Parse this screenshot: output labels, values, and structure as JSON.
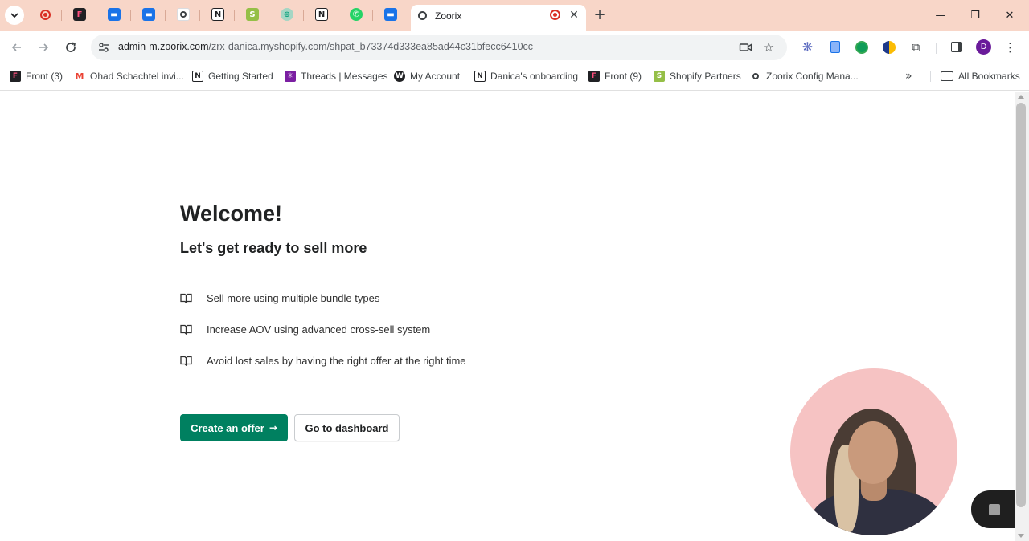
{
  "browser": {
    "active_tab": {
      "title": "Zoorix",
      "favicon": "zoorix-icon"
    },
    "pinned_tabs": [
      {
        "icon": "record-icon",
        "color": "#d93025"
      },
      {
        "icon": "front-icon",
        "color": "#c2185b"
      },
      {
        "icon": "messages-icon",
        "color": "#1a73e8"
      },
      {
        "icon": "messages-icon",
        "color": "#1a73e8"
      },
      {
        "icon": "zoorix-icon",
        "color": "#3c4043"
      },
      {
        "icon": "notion-icon",
        "color": "#202124"
      },
      {
        "icon": "shopify-icon",
        "color": "#5e8e3e"
      },
      {
        "icon": "chatgpt-icon",
        "color": "#10a37f"
      },
      {
        "icon": "notion-icon",
        "color": "#202124"
      },
      {
        "icon": "whatsapp-icon",
        "color": "#25d366"
      },
      {
        "icon": "messages-icon",
        "color": "#1a73e8"
      }
    ],
    "url_host": "admin-m.zoorix.com",
    "url_path": "/zrx-danica.myshopify.com/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",
    "profile_initial": "D",
    "bookmarks": [
      {
        "label": "Front (3)",
        "icon": "front-icon",
        "color": "#c2185b"
      },
      {
        "label": "Ohad Schachtel invi...",
        "icon": "gmail-icon",
        "color": "#ea4335"
      },
      {
        "label": "Getting Started",
        "icon": "notion-icon",
        "color": "#202124"
      },
      {
        "label": "Threads | Messages",
        "icon": "threads-icon",
        "color": "#7b1fa2"
      },
      {
        "label": "My Account",
        "icon": "account-icon",
        "color": "#202124"
      },
      {
        "label": "Danica's onboarding",
        "icon": "notion-icon",
        "color": "#202124"
      },
      {
        "label": "Front (9)",
        "icon": "front-icon",
        "color": "#c2185b"
      },
      {
        "label": "Shopify Partners",
        "icon": "shopify-icon",
        "color": "#5e8e3e"
      },
      {
        "label": "Zoorix Config Mana...",
        "icon": "zoorix-icon",
        "color": "#3c4043"
      }
    ],
    "all_bookmarks_label": "All Bookmarks"
  },
  "page": {
    "title": "Welcome!",
    "subtitle": "Let's get ready to sell more",
    "features": [
      {
        "text": "Sell more using multiple bundle types",
        "icon": "book-icon"
      },
      {
        "text": "Increase AOV using advanced cross-sell system",
        "icon": "book-icon"
      },
      {
        "text": "Avoid lost sales by having the right offer at the right time",
        "icon": "book-icon"
      }
    ],
    "primary_button": "Create an offer",
    "primary_button_arrow": "→",
    "secondary_button": "Go to dashboard",
    "accent_color": "#008060"
  }
}
